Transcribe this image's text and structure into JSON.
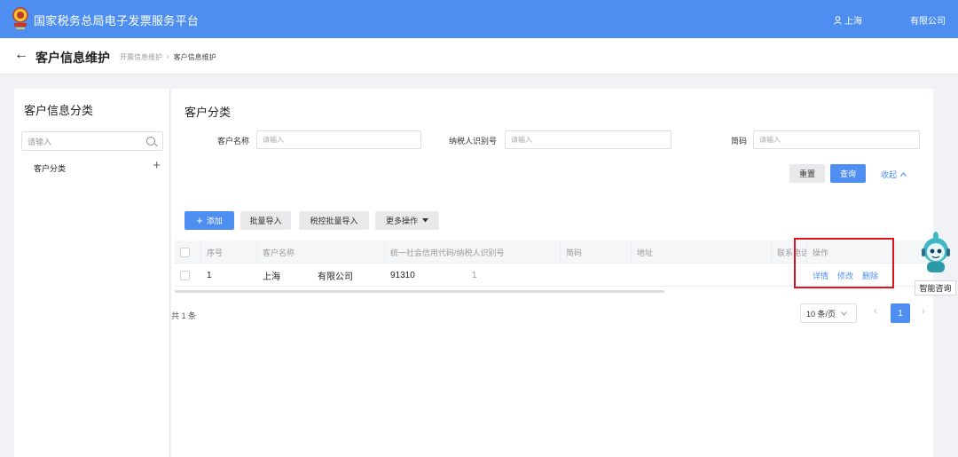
{
  "header": {
    "app_title": "国家税务总局电子发票服务平台",
    "user": "上海",
    "company": "有限公司",
    "brand_color": "#4d8ef0"
  },
  "subheader": {
    "title": "客户信息维护",
    "breadcrumb": [
      "开票信息维护",
      "客户信息维护"
    ]
  },
  "left_panel": {
    "title": "客户信息分类",
    "search_placeholder": "请输入",
    "tree_items": [
      "客户分类"
    ]
  },
  "main": {
    "title": "客户分类",
    "filters": [
      {
        "label": "客户名称",
        "placeholder": "请输入"
      },
      {
        "label": "纳税人识别号",
        "placeholder": "请输入"
      },
      {
        "label": "简码",
        "placeholder": "请输入"
      }
    ],
    "buttons": {
      "reset": "重置",
      "query": "查询",
      "collapse": "收起",
      "add": "添加",
      "batch_import": "批量导入",
      "tax_batch_import": "税控批量导入",
      "more_actions": "更多操作"
    },
    "table": {
      "columns": [
        "序号",
        "客户名称",
        "统一社会信用代码/纳税人识别号",
        "简码",
        "地址",
        "联系电话",
        "操作"
      ],
      "rows": [
        {
          "index": "1",
          "name": "上海",
          "name_suffix": "有限公司",
          "tax_id": "91310",
          "tax_id_suffix": "1",
          "short_code": "",
          "address": "",
          "phone": "",
          "actions": [
            "详情",
            "修改",
            "删除"
          ]
        }
      ]
    },
    "pagination": {
      "total": "共 1 条",
      "page_size": "10 条/页",
      "current_page": "1"
    }
  },
  "assistant": {
    "label": "智能咨询"
  },
  "highlight_color": "#e0121b"
}
